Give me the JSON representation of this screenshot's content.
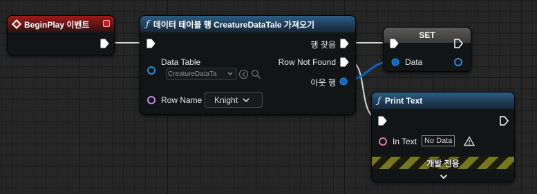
{
  "event_node": {
    "title": "BeginPlay 이벤트"
  },
  "get_row_node": {
    "title": "데이터 테이블 행 CreatureDataTale 가져오기",
    "data_table_label": "Data Table",
    "data_table_value": "CreatureDataTa",
    "row_name_label": "Row Name",
    "row_name_value": "Knight",
    "row_found_label": "행 찾음",
    "row_not_found_label": "Row Not Found",
    "out_row_label": "아웃 행"
  },
  "set_node": {
    "title": "SET",
    "data_label": "Data"
  },
  "print_node": {
    "title": "Print Text",
    "in_text_label": "In Text",
    "in_text_value": "No Data",
    "dev_only_label": "개발 전용"
  },
  "colors": {
    "exec_pin": "#ffffff",
    "struct_pin": "#0a68c8",
    "name_pin": "#c88ae6",
    "text_pin": "#e07aa0",
    "event_header": "#a01a1a",
    "function_header": "#2c5d83"
  },
  "icons": {
    "event": "diamond-event-icon",
    "function": "function-f-icon",
    "browse": "arrow-left-circle-icon",
    "search": "magnifier-icon",
    "warning": "warning-triangle-icon",
    "expand": "chevron-down-icon"
  }
}
